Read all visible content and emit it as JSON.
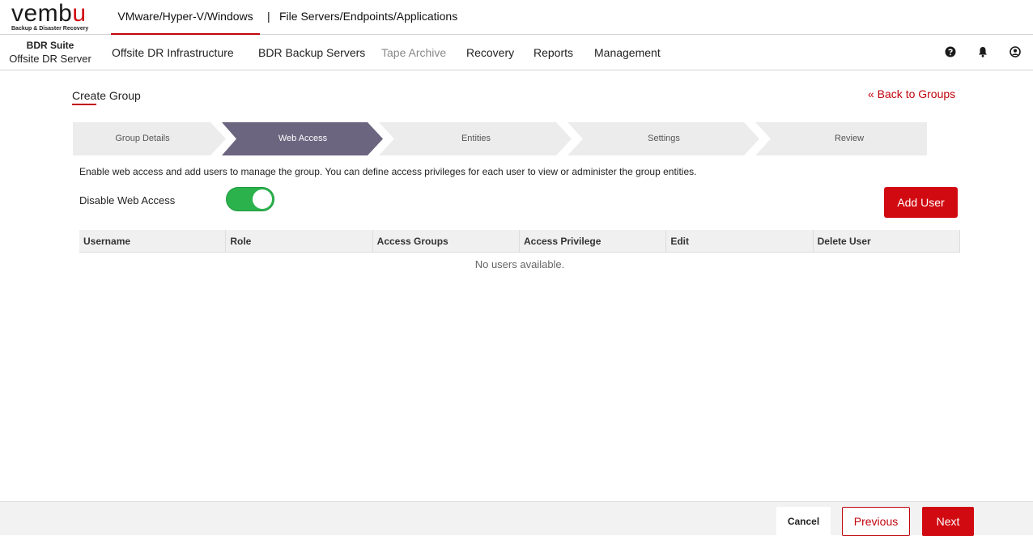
{
  "logo": {
    "word_start": "vemb",
    "word_end": "u",
    "tagline": "Backup & Disaster Recovery"
  },
  "product_tabs": [
    {
      "label": "VMware/Hyper-V/Windows",
      "active": true
    },
    {
      "label": "File Servers/Endpoints/Applications",
      "active": false
    }
  ],
  "product_separator": "|",
  "suite": {
    "name": "BDR Suite",
    "server": "Offsite DR Server"
  },
  "nav": [
    {
      "label": "Offsite DR Infrastructure",
      "enabled": true
    },
    {
      "label": "BDR Backup Servers",
      "enabled": true
    },
    {
      "label": "Tape Archive",
      "enabled": false
    },
    {
      "label": "Recovery",
      "enabled": true
    },
    {
      "label": "Reports",
      "enabled": true
    },
    {
      "label": "Management",
      "enabled": true
    }
  ],
  "header_icons": [
    "help-icon",
    "bell-icon",
    "user-icon"
  ],
  "page": {
    "title": "Create Group",
    "back_link": "« Back to Groups"
  },
  "steps": [
    {
      "label": "Group Details",
      "active": false
    },
    {
      "label": "Web Access",
      "active": true
    },
    {
      "label": "Entities",
      "active": false
    },
    {
      "label": "Settings",
      "active": false
    },
    {
      "label": "Review",
      "active": false
    }
  ],
  "web_access": {
    "description": "Enable web access and add users to manage the group. You can define access privileges for each user to view or administer the group entities.",
    "toggle_label": "Disable Web Access",
    "toggle_on": true,
    "add_user_label": "Add User"
  },
  "table": {
    "columns": [
      "Username",
      "Role",
      "Access Groups",
      "Access Privilege",
      "Edit",
      "Delete User"
    ],
    "empty_message": "No users available."
  },
  "footer": {
    "cancel": "Cancel",
    "previous": "Previous",
    "next": "Next"
  },
  "colors": {
    "brand_red": "#d10a11",
    "step_active": "#6b6580",
    "step_inactive": "#ececec",
    "toggle_on": "#2bb24c"
  }
}
